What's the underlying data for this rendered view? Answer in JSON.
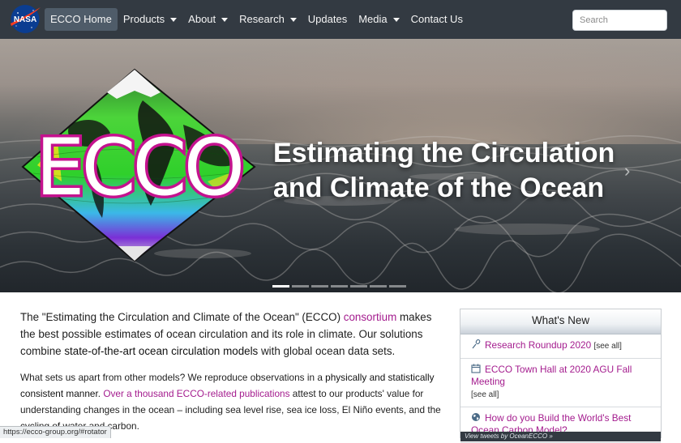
{
  "navbar": {
    "logo_text": "NASA",
    "items": [
      {
        "label": "ECCO Home",
        "active": true,
        "dropdown": false
      },
      {
        "label": "Products",
        "dropdown": true
      },
      {
        "label": "About",
        "dropdown": true
      },
      {
        "label": "Research",
        "dropdown": true
      },
      {
        "label": "Updates",
        "dropdown": false
      },
      {
        "label": "Media",
        "dropdown": true
      },
      {
        "label": "Contact Us",
        "dropdown": false
      }
    ],
    "search_placeholder": "Search"
  },
  "hero": {
    "logo_text": "ECCO",
    "title": "Estimating the Circulation and Climate of the Ocean",
    "next_icon": "chevron-right-icon",
    "slide_count": 7,
    "active_slide": 1
  },
  "main": {
    "lead_1": "The \"Estimating the Circulation and Climate of the Ocean\" (ECCO) ",
    "lead_link": "consortium",
    "lead_2": " makes the best possible estimates of ocean circulation and its role in climate. Our solutions combine ",
    "lead_strong": "state-of-the-art ocean circulation models",
    "lead_3": " with global ocean data sets.",
    "p2_1": "What sets us apart from other models? We reproduce observations in a ",
    "p2_strong": "physically and statistically consistent manner",
    "p2_2": ". ",
    "p2_link": "Over a thousand ECCO-related publications",
    "p2_3": " attest to our products' value for understanding changes in the ocean – including sea level rise, sea ice loss, El Niño events, and the cycling of water and carbon."
  },
  "sidebar": {
    "title": "What's New",
    "items": [
      {
        "icon": "microphone-icon",
        "title": "Research Roundup 2020",
        "see_all": "[see all]"
      },
      {
        "icon": "calendar-icon",
        "title": "ECCO Town Hall at 2020 AGU Fall Meeting",
        "see_all": "[see all]"
      },
      {
        "icon": "globe-icon",
        "title": "How do you Build the World's Best Ocean Carbon Model?",
        "see_all": ""
      }
    ],
    "twitter": "View tweets by OceanECCO »"
  },
  "status_bar": {
    "url": "https://ecco-group.org/#rotator"
  },
  "colors": {
    "navbar": "#333a42",
    "link": "#a41c8e",
    "active_nav": "#4f5c69"
  }
}
